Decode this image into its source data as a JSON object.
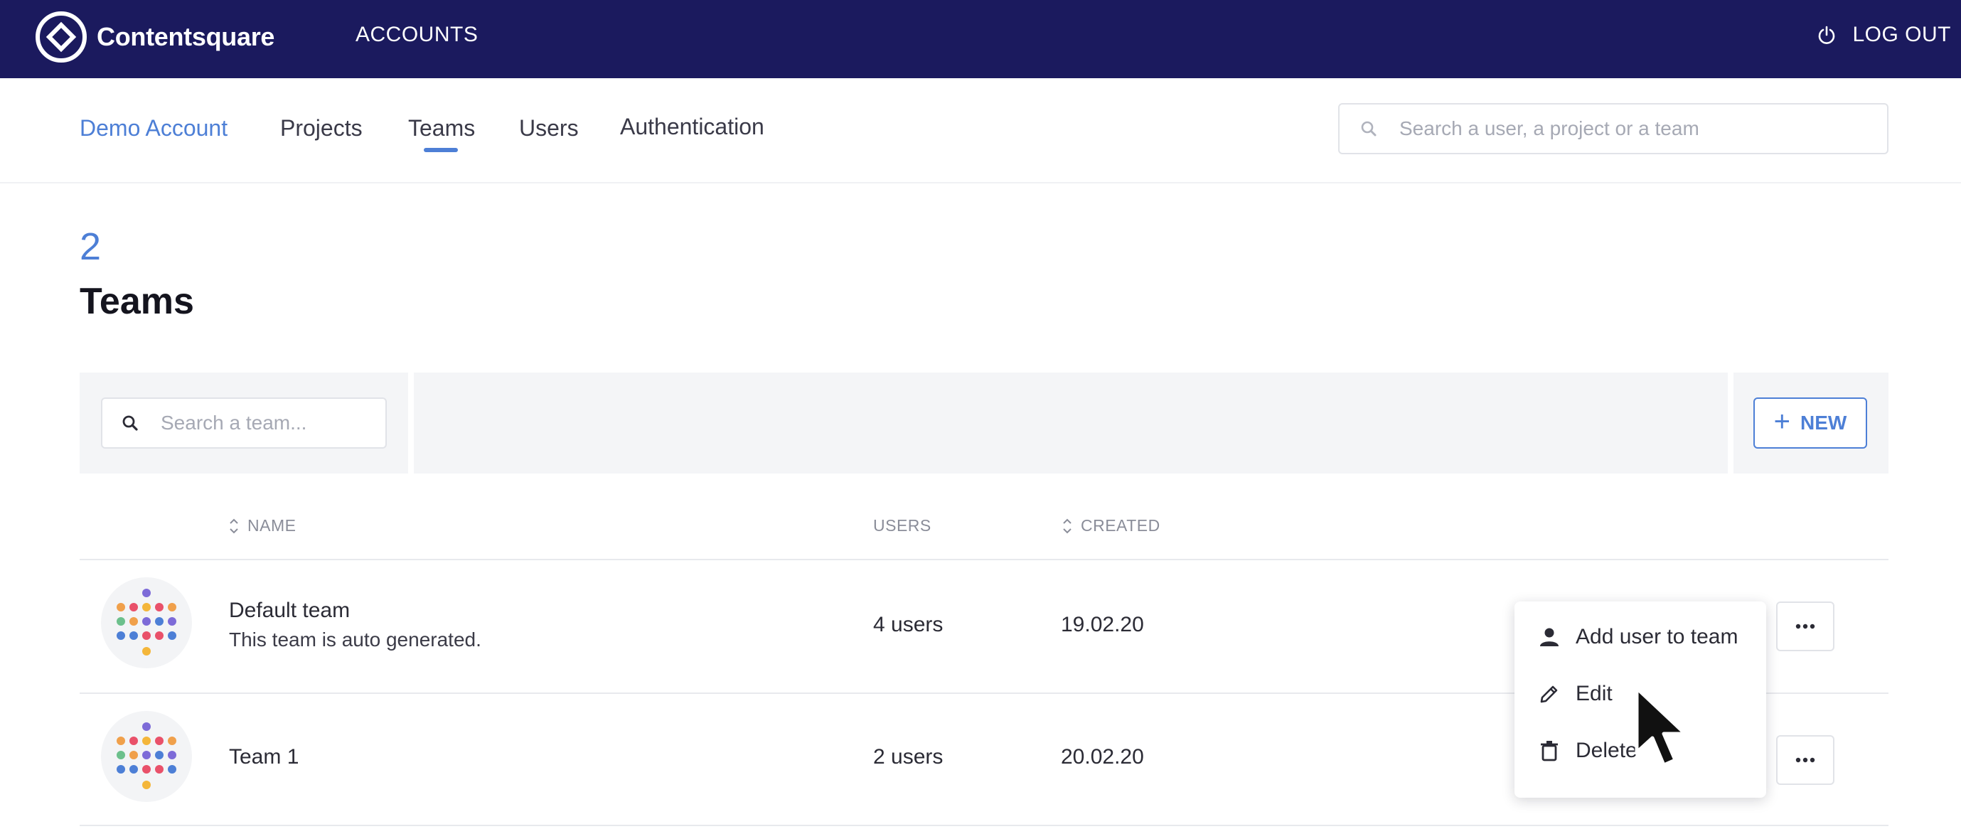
{
  "topbar": {
    "brand": "Contentsquare",
    "accounts_label": "ACCOUNTS",
    "logout_label": "LOG OUT"
  },
  "subnav": {
    "account": "Demo Account",
    "items": [
      {
        "label": "Projects"
      },
      {
        "label": "Teams",
        "active": true
      },
      {
        "label": "Users"
      },
      {
        "label": "Authentication"
      }
    ],
    "search_placeholder": "Search a user, a project or a team"
  },
  "page": {
    "count": "2",
    "title": "Teams"
  },
  "toolbar": {
    "search_placeholder": "Search a team...",
    "new_label": "NEW"
  },
  "table": {
    "columns": {
      "name": "NAME",
      "users": "USERS",
      "created": "CREATED"
    },
    "rows": [
      {
        "name": "Default team",
        "description": "This team is auto generated.",
        "users": "4 users",
        "created": "19.02.20"
      },
      {
        "name": "Team 1",
        "description": "",
        "users": "2 users",
        "created": "20.02.20"
      }
    ]
  },
  "menu": {
    "items": [
      {
        "label": "Add user to team",
        "icon": "person-icon"
      },
      {
        "label": "Edit",
        "icon": "pencil-icon"
      },
      {
        "label": "Delete",
        "icon": "trash-icon"
      }
    ]
  },
  "colors": {
    "topbar": "#1b1a5e",
    "accent": "#4d7fd6",
    "toolbar_bg": "#f4f5f7"
  }
}
